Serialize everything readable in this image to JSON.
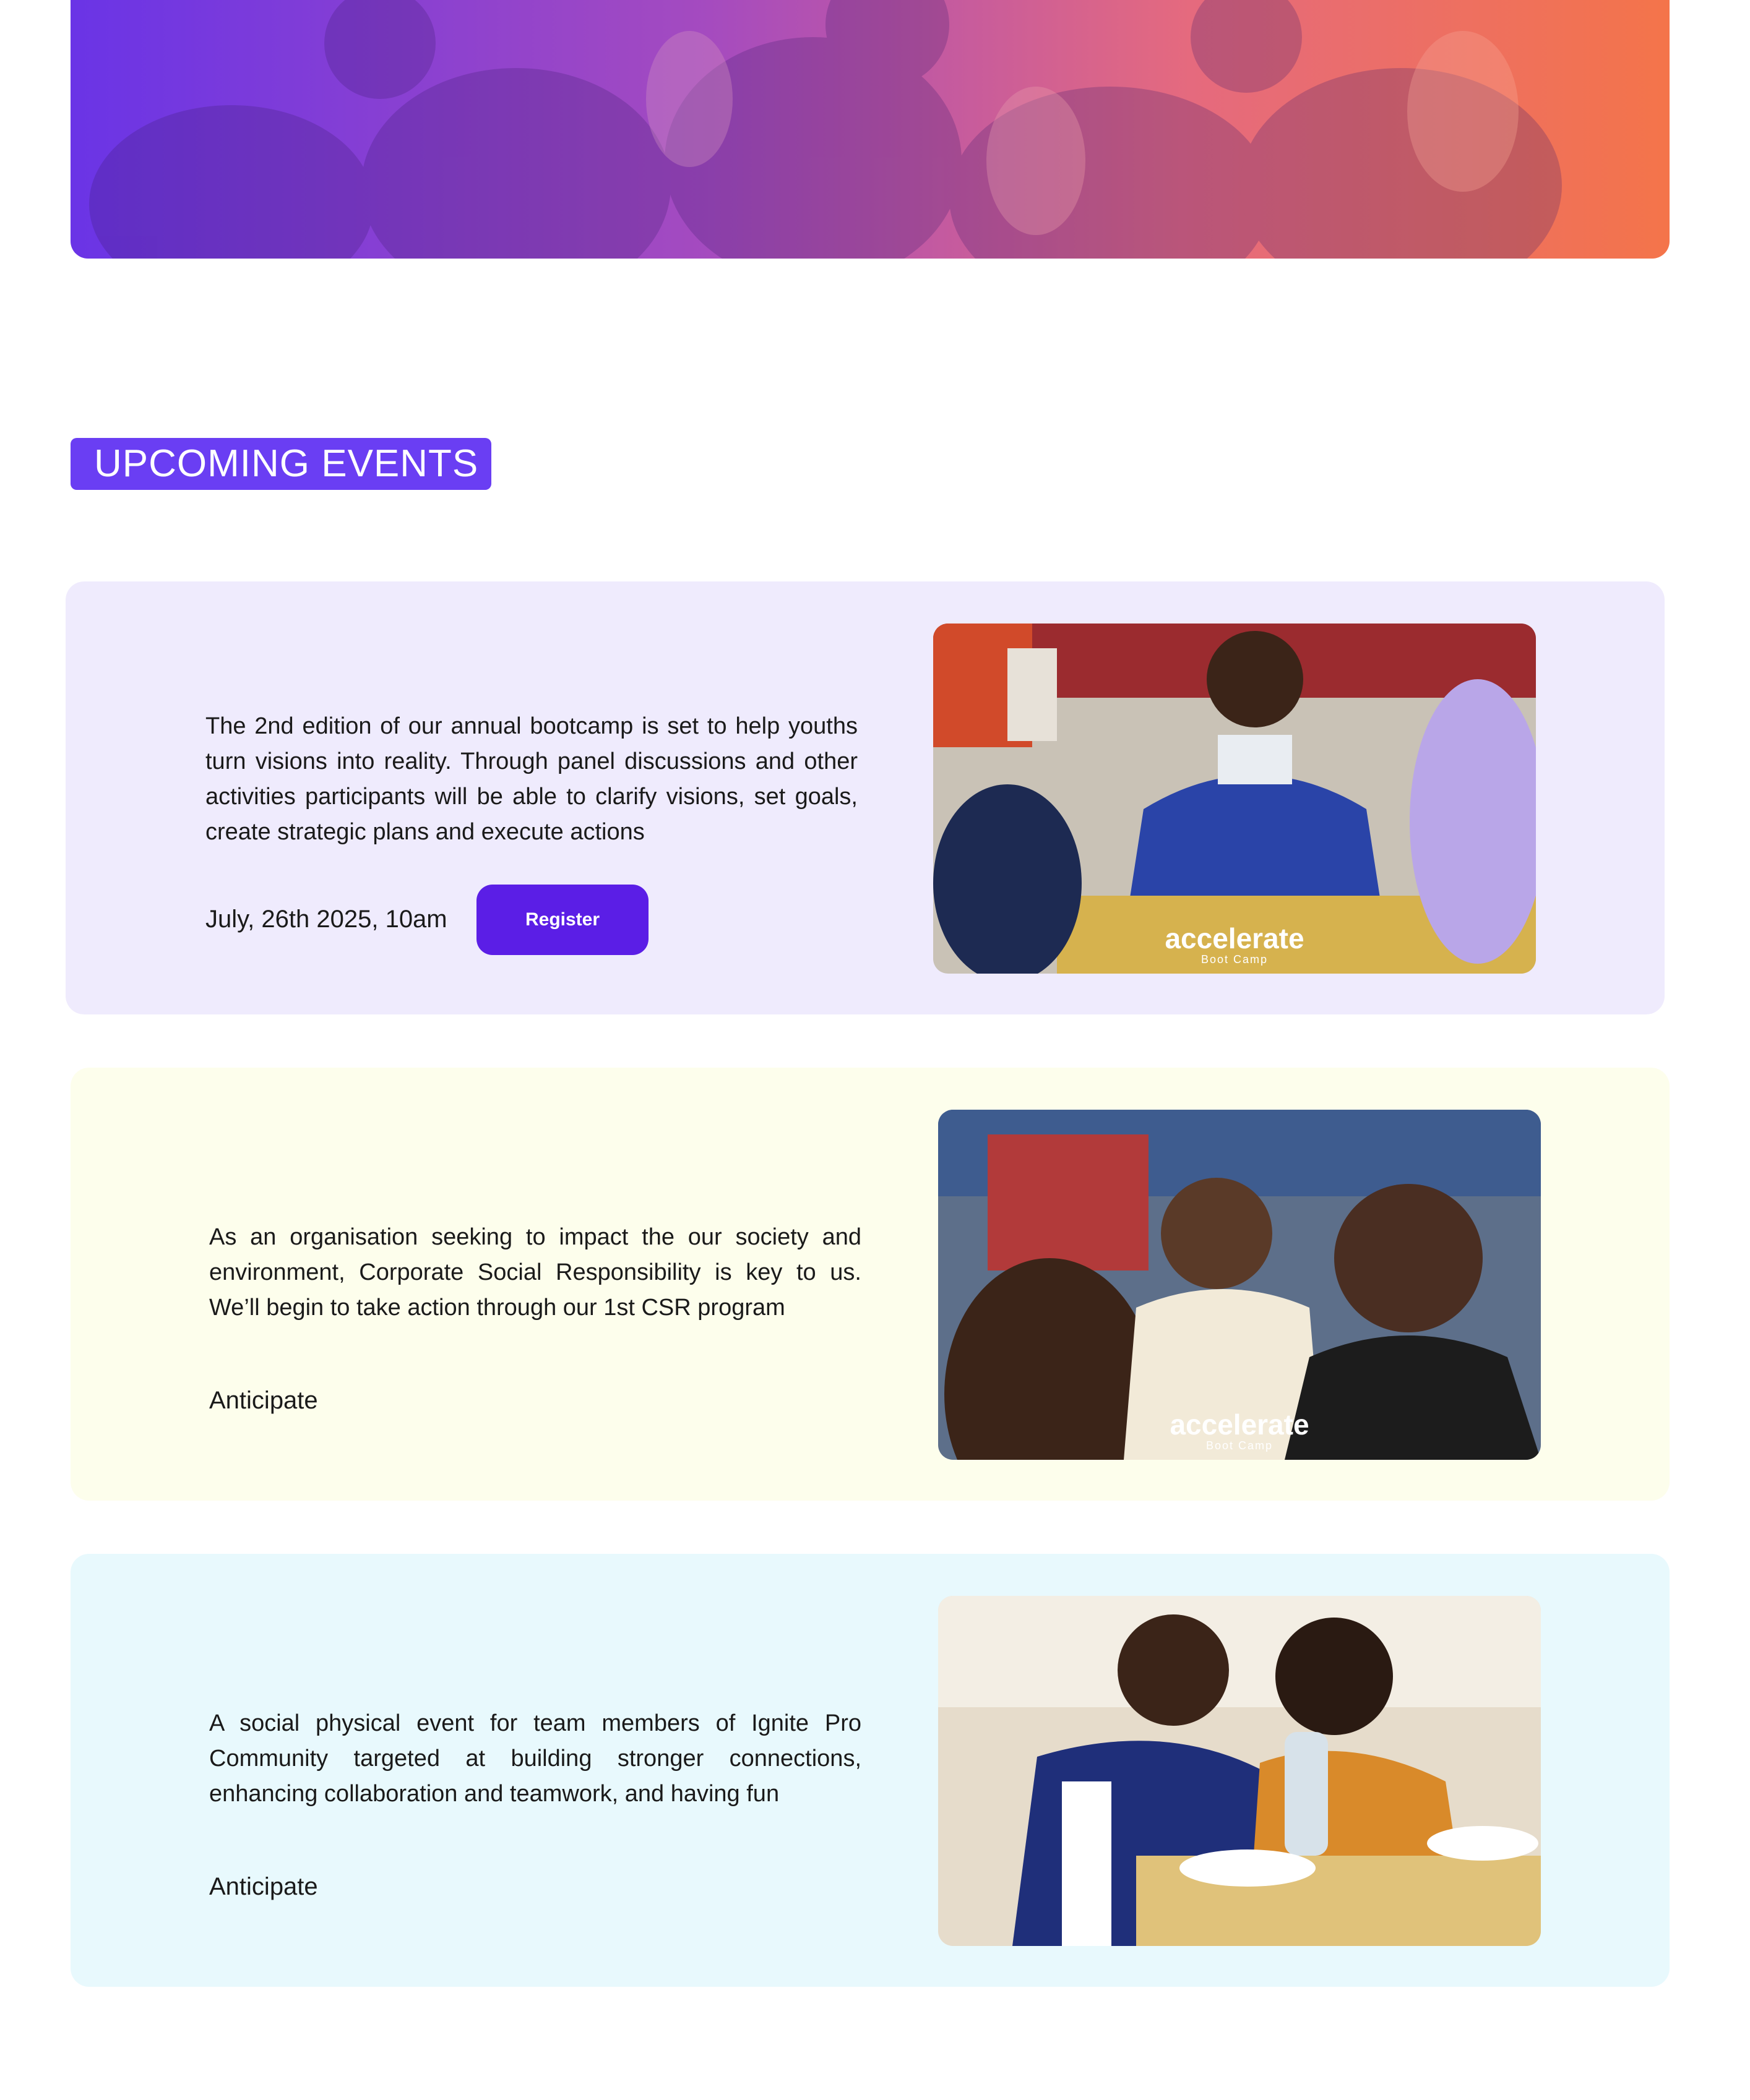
{
  "section": {
    "title": "UPCOMING EVENTS"
  },
  "events": [
    {
      "description": "The 2nd edition of our annual bootcamp is set to help youths turn visions into reality. Through panel discussions and other activities participants will be able to clarify visions, set goals, create strategic plans and execute actions",
      "date": "July, 26th 2025, 10am",
      "button_label": "Register",
      "photo_badge": {
        "brand": "accelerate",
        "sub": "Boot Camp"
      }
    },
    {
      "description": "As an organisation seeking to impact the our society and environment, Corporate Social Responsibility is key to us. We’ll begin to take action through our 1st CSR program",
      "date": "Anticipate",
      "photo_badge": {
        "brand": "accelerate",
        "sub": "Boot Camp"
      }
    },
    {
      "description": "A social physical event for team members of Ignite Pro Community targeted at building stronger connections, enhancing collaboration and teamwork, and having fun",
      "date": "Anticipate"
    }
  ],
  "colors": {
    "accent": "#6a3ef3",
    "button": "#5b1ee6",
    "card_1_bg": "#efebfd",
    "card_2_bg": "#fdfeec",
    "card_3_bg": "#e8f9fd"
  }
}
